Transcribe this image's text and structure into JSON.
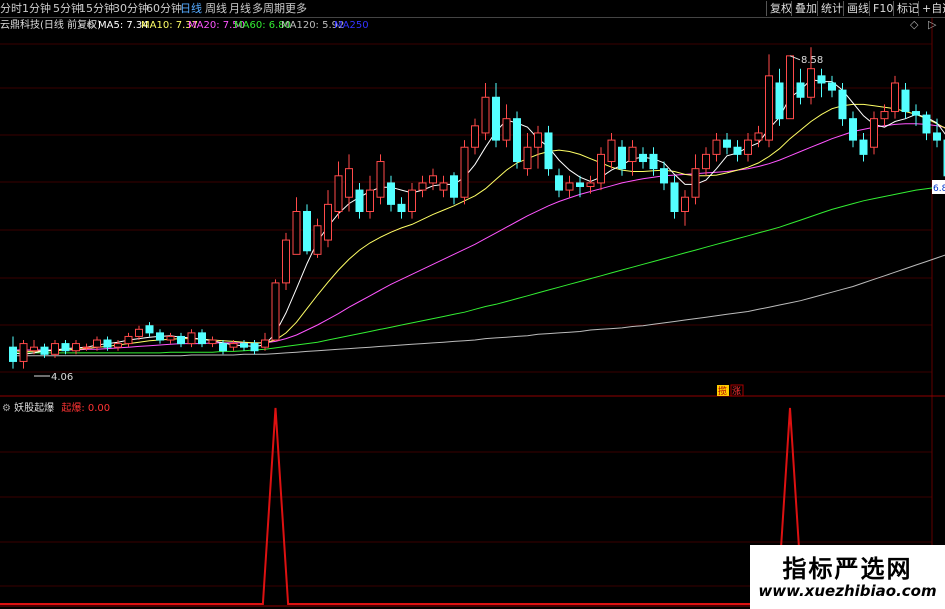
{
  "toolbar": {
    "periods": [
      "分时",
      "1分钟",
      "5分钟",
      "15分钟",
      "30分钟",
      "60分钟",
      "日线",
      "周线",
      "月线",
      "多周期",
      "更多"
    ],
    "active_period": "日线",
    "right_buttons": [
      "复权",
      "叠加",
      "统计",
      "画线",
      "F10",
      "标记",
      "+自选"
    ]
  },
  "legend": {
    "stock": "云鼎科技(日线 前复权)",
    "ma5": "MA5: 7.34",
    "ma10": "MA10: 7.37",
    "ma20": "MA20: 7.50",
    "ma60": "MA60: 6.80",
    "ma120": "MA120: 5.92",
    "ma250": "MA250"
  },
  "chart_labels": {
    "high_label": "8.58",
    "low_label": "4.06",
    "right_price": "6.8",
    "marker1": "揽",
    "marker2": "涨"
  },
  "indicator": {
    "name": "妖股起爆",
    "series_label": "起爆: 0.00"
  },
  "watermark": {
    "cn": "指标严选网",
    "en": "www.xuezhibiao.com"
  },
  "colors": {
    "up": "#ff4a4a",
    "down": "#54ffff",
    "ma5": "#ffffff",
    "ma10": "#ffff66",
    "ma20": "#ff55ff",
    "ma60": "#33ee33",
    "ma120": "#bbbbbb",
    "ma250": "#3333ff",
    "signal": "#dd1111"
  },
  "chart_data": {
    "type": "candlestick",
    "price_range": [
      3.9,
      8.9
    ],
    "candles": [
      [
        4.5,
        4.3,
        4.65,
        4.2
      ],
      [
        4.3,
        4.55,
        4.6,
        4.2
      ],
      [
        4.45,
        4.5,
        4.6,
        4.4
      ],
      [
        4.5,
        4.4,
        4.55,
        4.35
      ],
      [
        4.4,
        4.55,
        4.6,
        4.35
      ],
      [
        4.55,
        4.45,
        4.6,
        4.4
      ],
      [
        4.45,
        4.55,
        4.6,
        4.4
      ],
      [
        4.5,
        4.5,
        4.55,
        4.45
      ],
      [
        4.5,
        4.6,
        4.65,
        4.45
      ],
      [
        4.6,
        4.5,
        4.65,
        4.45
      ],
      [
        4.5,
        4.55,
        4.6,
        4.45
      ],
      [
        4.55,
        4.65,
        4.7,
        4.5
      ],
      [
        4.65,
        4.75,
        4.8,
        4.6
      ],
      [
        4.8,
        4.7,
        4.85,
        4.65
      ],
      [
        4.7,
        4.6,
        4.75,
        4.55
      ],
      [
        4.6,
        4.65,
        4.7,
        4.55
      ],
      [
        4.65,
        4.55,
        4.7,
        4.5
      ],
      [
        4.55,
        4.7,
        4.75,
        4.5
      ],
      [
        4.7,
        4.55,
        4.75,
        4.5
      ],
      [
        4.55,
        4.6,
        4.65,
        4.5
      ],
      [
        4.55,
        4.45,
        4.6,
        4.4
      ],
      [
        4.5,
        4.55,
        4.6,
        4.45
      ],
      [
        4.55,
        4.5,
        4.6,
        4.45
      ],
      [
        4.55,
        4.45,
        4.6,
        4.4
      ],
      [
        4.5,
        4.6,
        4.7,
        4.45
      ],
      [
        4.6,
        5.4,
        5.45,
        4.6
      ],
      [
        5.4,
        6.0,
        6.1,
        5.3
      ],
      [
        5.8,
        6.4,
        6.6,
        5.8
      ],
      [
        6.4,
        5.85,
        6.5,
        5.8
      ],
      [
        5.8,
        6.2,
        6.3,
        5.75
      ],
      [
        6.0,
        6.5,
        6.7,
        5.9
      ],
      [
        6.4,
        6.9,
        7.1,
        6.3
      ],
      [
        6.6,
        7.0,
        7.2,
        6.4
      ],
      [
        6.7,
        6.4,
        6.8,
        6.3
      ],
      [
        6.4,
        6.7,
        6.9,
        6.3
      ],
      [
        6.6,
        7.1,
        7.2,
        6.5
      ],
      [
        6.8,
        6.5,
        6.9,
        6.4
      ],
      [
        6.5,
        6.4,
        6.6,
        6.3
      ],
      [
        6.4,
        6.7,
        6.8,
        6.3
      ],
      [
        6.7,
        6.8,
        6.9,
        6.6
      ],
      [
        6.8,
        6.9,
        7.0,
        6.7
      ],
      [
        6.7,
        6.8,
        6.9,
        6.6
      ],
      [
        6.9,
        6.6,
        6.95,
        6.5
      ],
      [
        6.6,
        7.3,
        7.4,
        6.5
      ],
      [
        7.3,
        7.6,
        7.7,
        7.2
      ],
      [
        7.5,
        8.0,
        8.2,
        7.4
      ],
      [
        8.0,
        7.4,
        8.2,
        7.3
      ],
      [
        7.4,
        7.7,
        7.9,
        7.3
      ],
      [
        7.7,
        7.1,
        7.8,
        7.0
      ],
      [
        7.0,
        7.3,
        7.5,
        6.9
      ],
      [
        7.3,
        7.5,
        7.6,
        7.0
      ],
      [
        7.5,
        7.0,
        7.6,
        6.9
      ],
      [
        6.9,
        6.7,
        7.0,
        6.6
      ],
      [
        6.7,
        6.8,
        6.9,
        6.6
      ],
      [
        6.8,
        6.75,
        6.9,
        6.6
      ],
      [
        6.75,
        6.8,
        6.9,
        6.65
      ],
      [
        6.8,
        7.2,
        7.3,
        6.7
      ],
      [
        7.1,
        7.4,
        7.5,
        7.0
      ],
      [
        7.3,
        7.0,
        7.4,
        6.9
      ],
      [
        7.1,
        7.3,
        7.4,
        6.9
      ],
      [
        7.2,
        7.1,
        7.3,
        7.0
      ],
      [
        7.2,
        7.0,
        7.3,
        6.9
      ],
      [
        7.0,
        6.8,
        7.1,
        6.7
      ],
      [
        6.8,
        6.4,
        6.9,
        6.3
      ],
      [
        6.4,
        6.6,
        6.7,
        6.2
      ],
      [
        6.6,
        7.0,
        7.2,
        6.5
      ],
      [
        7.0,
        7.2,
        7.3,
        6.9
      ],
      [
        7.2,
        7.4,
        7.5,
        7.1
      ],
      [
        7.4,
        7.3,
        7.5,
        7.2
      ],
      [
        7.3,
        7.2,
        7.4,
        7.1
      ],
      [
        7.2,
        7.4,
        7.5,
        7.1
      ],
      [
        7.4,
        7.5,
        7.6,
        7.3
      ],
      [
        7.4,
        8.3,
        8.6,
        7.3
      ],
      [
        8.2,
        7.7,
        8.4,
        7.6
      ],
      [
        7.7,
        8.58,
        8.58,
        7.7
      ],
      [
        8.2,
        8.0,
        8.4,
        7.9
      ],
      [
        8.0,
        8.4,
        8.7,
        7.9
      ],
      [
        8.3,
        8.2,
        8.4,
        8.0
      ],
      [
        8.2,
        8.1,
        8.3,
        8.0
      ],
      [
        8.1,
        7.7,
        8.2,
        7.6
      ],
      [
        7.7,
        7.4,
        7.8,
        7.3
      ],
      [
        7.4,
        7.2,
        7.5,
        7.1
      ],
      [
        7.3,
        7.7,
        7.8,
        7.2
      ],
      [
        7.7,
        7.8,
        7.9,
        7.6
      ],
      [
        7.8,
        8.2,
        8.3,
        7.7
      ],
      [
        8.1,
        7.8,
        8.2,
        7.7
      ],
      [
        7.8,
        7.75,
        7.9,
        7.6
      ],
      [
        7.75,
        7.5,
        7.8,
        7.4
      ],
      [
        7.5,
        7.4,
        7.7,
        7.3
      ],
      [
        7.4,
        6.9,
        7.5,
        6.8
      ],
      [
        6.9,
        6.95,
        7.1,
        6.8
      ],
      [
        7.0,
        6.8,
        7.1,
        6.6
      ]
    ],
    "ma5": [
      4.42,
      4.4,
      4.42,
      4.45,
      4.46,
      4.48,
      4.49,
      4.5,
      4.53,
      4.55,
      4.57,
      4.6,
      4.62,
      4.64,
      4.65,
      4.66,
      4.64,
      4.63,
      4.61,
      4.59,
      4.56,
      4.53,
      4.52,
      4.51,
      4.53,
      4.7,
      4.98,
      5.32,
      5.67,
      5.98,
      6.19,
      6.37,
      6.51,
      6.6,
      6.68,
      6.74,
      6.74,
      6.7,
      6.66,
      6.7,
      6.76,
      6.78,
      6.78,
      6.88,
      7.06,
      7.3,
      7.52,
      7.68,
      7.64,
      7.58,
      7.42,
      7.3,
      7.12,
      6.98,
      6.88,
      6.82,
      6.88,
      6.98,
      7.05,
      7.14,
      7.16,
      7.14,
      7.08,
      6.92,
      6.78,
      6.78,
      6.84,
      7.0,
      7.18,
      7.22,
      7.3,
      7.36,
      7.56,
      7.72,
      8.0,
      8.1,
      8.25,
      8.22,
      8.22,
      8.1,
      7.92,
      7.74,
      7.62,
      7.58,
      7.66,
      7.7,
      7.76,
      7.72,
      7.64,
      7.44,
      7.26,
      7.1
    ],
    "ma10": [
      4.45,
      4.44,
      4.44,
      4.45,
      4.45,
      4.46,
      4.47,
      4.48,
      4.5,
      4.51,
      4.53,
      4.55,
      4.57,
      4.59,
      4.6,
      4.61,
      4.62,
      4.62,
      4.61,
      4.6,
      4.59,
      4.58,
      4.57,
      4.56,
      4.56,
      4.6,
      4.7,
      4.85,
      5.04,
      5.23,
      5.41,
      5.58,
      5.73,
      5.86,
      5.96,
      6.04,
      6.11,
      6.17,
      6.22,
      6.29,
      6.36,
      6.42,
      6.48,
      6.55,
      6.62,
      6.72,
      6.85,
      6.98,
      7.08,
      7.14,
      7.2,
      7.24,
      7.26,
      7.24,
      7.2,
      7.14,
      7.08,
      7.02,
      6.98,
      6.96,
      6.96,
      6.97,
      6.98,
      6.96,
      6.92,
      6.9,
      6.9,
      6.91,
      6.94,
      6.98,
      7.02,
      7.08,
      7.17,
      7.28,
      7.42,
      7.54,
      7.66,
      7.76,
      7.84,
      7.88,
      7.9,
      7.9,
      7.88,
      7.86,
      7.84,
      7.8,
      7.76,
      7.7,
      7.63,
      7.55,
      7.47,
      7.37
    ],
    "ma20": [
      4.46,
      4.46,
      4.46,
      4.46,
      4.46,
      4.46,
      4.46,
      4.47,
      4.47,
      4.48,
      4.49,
      4.5,
      4.51,
      4.52,
      4.53,
      4.54,
      4.55,
      4.55,
      4.55,
      4.56,
      4.56,
      4.56,
      4.56,
      4.56,
      4.56,
      4.58,
      4.62,
      4.67,
      4.74,
      4.81,
      4.89,
      4.97,
      5.06,
      5.14,
      5.22,
      5.3,
      5.38,
      5.45,
      5.52,
      5.59,
      5.66,
      5.73,
      5.8,
      5.87,
      5.94,
      6.02,
      6.1,
      6.18,
      6.26,
      6.34,
      6.41,
      6.48,
      6.54,
      6.59,
      6.64,
      6.68,
      6.72,
      6.76,
      6.8,
      6.83,
      6.86,
      6.88,
      6.9,
      6.91,
      6.92,
      6.93,
      6.94,
      6.95,
      6.96,
      6.98,
      7.0,
      7.03,
      7.07,
      7.12,
      7.18,
      7.24,
      7.3,
      7.36,
      7.42,
      7.47,
      7.52,
      7.55,
      7.58,
      7.6,
      7.62,
      7.63,
      7.63,
      7.62,
      7.6,
      7.57,
      7.54,
      7.5
    ],
    "ma60": [
      4.42,
      4.42,
      4.42,
      4.42,
      4.42,
      4.42,
      4.42,
      4.42,
      4.42,
      4.42,
      4.42,
      4.42,
      4.42,
      4.42,
      4.42,
      4.43,
      4.43,
      4.43,
      4.43,
      4.43,
      4.44,
      4.44,
      4.45,
      4.46,
      4.47,
      4.49,
      4.51,
      4.53,
      4.55,
      4.57,
      4.6,
      4.63,
      4.66,
      4.69,
      4.72,
      4.75,
      4.78,
      4.81,
      4.84,
      4.87,
      4.9,
      4.93,
      4.96,
      4.99,
      5.03,
      5.07,
      5.1,
      5.14,
      5.18,
      5.22,
      5.26,
      5.3,
      5.34,
      5.38,
      5.42,
      5.46,
      5.5,
      5.54,
      5.58,
      5.62,
      5.66,
      5.7,
      5.74,
      5.78,
      5.82,
      5.86,
      5.9,
      5.94,
      5.98,
      6.02,
      6.06,
      6.1,
      6.14,
      6.18,
      6.23,
      6.28,
      6.33,
      6.38,
      6.43,
      6.47,
      6.51,
      6.55,
      6.58,
      6.61,
      6.64,
      6.67,
      6.7,
      6.72,
      6.74,
      6.76,
      6.78,
      6.8
    ],
    "ma120": [
      4.38,
      4.38,
      4.38,
      4.38,
      4.38,
      4.38,
      4.38,
      4.38,
      4.38,
      4.38,
      4.38,
      4.38,
      4.38,
      4.38,
      4.38,
      4.38,
      4.38,
      4.39,
      4.39,
      4.39,
      4.39,
      4.39,
      4.4,
      4.4,
      4.4,
      4.41,
      4.42,
      4.43,
      4.44,
      4.45,
      4.46,
      4.47,
      4.48,
      4.49,
      4.5,
      4.51,
      4.52,
      4.53,
      4.54,
      4.55,
      4.56,
      4.57,
      4.58,
      4.59,
      4.6,
      4.62,
      4.63,
      4.64,
      4.65,
      4.66,
      4.68,
      4.69,
      4.7,
      4.71,
      4.72,
      4.74,
      4.75,
      4.76,
      4.77,
      4.79,
      4.8,
      4.82,
      4.84,
      4.86,
      4.88,
      4.9,
      4.92,
      4.94,
      4.96,
      4.98,
      5.0,
      5.03,
      5.06,
      5.09,
      5.12,
      5.15,
      5.19,
      5.23,
      5.27,
      5.31,
      5.35,
      5.4,
      5.45,
      5.5,
      5.55,
      5.6,
      5.65,
      5.7,
      5.75,
      5.8,
      5.86,
      5.92
    ],
    "signal_bars": [
      25,
      74
    ],
    "indicator_range": [
      0,
      1
    ]
  }
}
